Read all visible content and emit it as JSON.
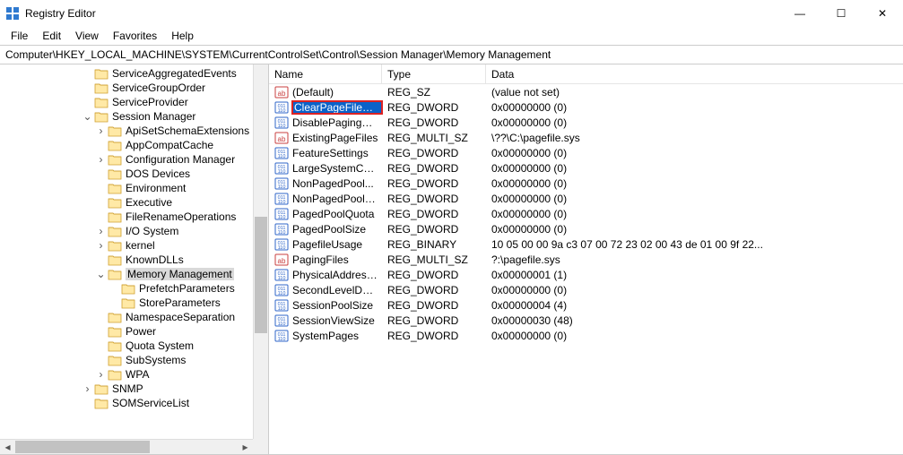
{
  "window": {
    "title": "Registry Editor",
    "controls": {
      "min": "—",
      "max": "☐",
      "close": "✕"
    }
  },
  "menu": [
    "File",
    "Edit",
    "View",
    "Favorites",
    "Help"
  ],
  "address": "Computer\\HKEY_LOCAL_MACHINE\\SYSTEM\\CurrentControlSet\\Control\\Session Manager\\Memory Management",
  "tree": [
    {
      "d": 6,
      "t": "",
      "l": "ServiceAggregatedEvents"
    },
    {
      "d": 6,
      "t": "",
      "l": "ServiceGroupOrder"
    },
    {
      "d": 6,
      "t": "",
      "l": "ServiceProvider"
    },
    {
      "d": 6,
      "t": "v",
      "l": "Session Manager"
    },
    {
      "d": 7,
      "t": ">",
      "l": "ApiSetSchemaExtensions"
    },
    {
      "d": 7,
      "t": "",
      "l": "AppCompatCache"
    },
    {
      "d": 7,
      "t": ">",
      "l": "Configuration Manager"
    },
    {
      "d": 7,
      "t": "",
      "l": "DOS Devices"
    },
    {
      "d": 7,
      "t": "",
      "l": "Environment"
    },
    {
      "d": 7,
      "t": "",
      "l": "Executive"
    },
    {
      "d": 7,
      "t": "",
      "l": "FileRenameOperations"
    },
    {
      "d": 7,
      "t": ">",
      "l": "I/O System"
    },
    {
      "d": 7,
      "t": ">",
      "l": "kernel"
    },
    {
      "d": 7,
      "t": "",
      "l": "KnownDLLs"
    },
    {
      "d": 7,
      "t": "v",
      "l": "Memory Management",
      "sel": true
    },
    {
      "d": 8,
      "t": "",
      "l": "PrefetchParameters"
    },
    {
      "d": 8,
      "t": "",
      "l": "StoreParameters"
    },
    {
      "d": 7,
      "t": "",
      "l": "NamespaceSeparation"
    },
    {
      "d": 7,
      "t": "",
      "l": "Power"
    },
    {
      "d": 7,
      "t": "",
      "l": "Quota System"
    },
    {
      "d": 7,
      "t": "",
      "l": "SubSystems"
    },
    {
      "d": 7,
      "t": ">",
      "l": "WPA"
    },
    {
      "d": 6,
      "t": ">",
      "l": "SNMP"
    },
    {
      "d": 6,
      "t": "",
      "l": "SOMServiceList"
    }
  ],
  "columns": {
    "name": "Name",
    "type": "Type",
    "data": "Data"
  },
  "values": [
    {
      "icon": "sz",
      "name": "(Default)",
      "type": "REG_SZ",
      "data": "(value not set)"
    },
    {
      "icon": "dw",
      "name": "ClearPageFileAt...",
      "type": "REG_DWORD",
      "data": "0x00000000 (0)",
      "hl": true
    },
    {
      "icon": "dw",
      "name": "DisablePagingEx...",
      "type": "REG_DWORD",
      "data": "0x00000000 (0)"
    },
    {
      "icon": "sz",
      "name": "ExistingPageFiles",
      "type": "REG_MULTI_SZ",
      "data": "\\??\\C:\\pagefile.sys"
    },
    {
      "icon": "dw",
      "name": "FeatureSettings",
      "type": "REG_DWORD",
      "data": "0x00000000 (0)"
    },
    {
      "icon": "dw",
      "name": "LargeSystemCac...",
      "type": "REG_DWORD",
      "data": "0x00000000 (0)"
    },
    {
      "icon": "dw",
      "name": "NonPagedPool...",
      "type": "REG_DWORD",
      "data": "0x00000000 (0)"
    },
    {
      "icon": "dw",
      "name": "NonPagedPoolS...",
      "type": "REG_DWORD",
      "data": "0x00000000 (0)"
    },
    {
      "icon": "dw",
      "name": "PagedPoolQuota",
      "type": "REG_DWORD",
      "data": "0x00000000 (0)"
    },
    {
      "icon": "dw",
      "name": "PagedPoolSize",
      "type": "REG_DWORD",
      "data": "0x00000000 (0)"
    },
    {
      "icon": "dw",
      "name": "PagefileUsage",
      "type": "REG_BINARY",
      "data": "10 05 00 00 9a c3 07 00 72 23 02 00 43 de 01 00 9f 22..."
    },
    {
      "icon": "sz",
      "name": "PagingFiles",
      "type": "REG_MULTI_SZ",
      "data": "?:\\pagefile.sys"
    },
    {
      "icon": "dw",
      "name": "PhysicalAddress...",
      "type": "REG_DWORD",
      "data": "0x00000001 (1)"
    },
    {
      "icon": "dw",
      "name": "SecondLevelDat...",
      "type": "REG_DWORD",
      "data": "0x00000000 (0)"
    },
    {
      "icon": "dw",
      "name": "SessionPoolSize",
      "type": "REG_DWORD",
      "data": "0x00000004 (4)"
    },
    {
      "icon": "dw",
      "name": "SessionViewSize",
      "type": "REG_DWORD",
      "data": "0x00000030 (48)"
    },
    {
      "icon": "dw",
      "name": "SystemPages",
      "type": "REG_DWORD",
      "data": "0x00000000 (0)"
    }
  ]
}
